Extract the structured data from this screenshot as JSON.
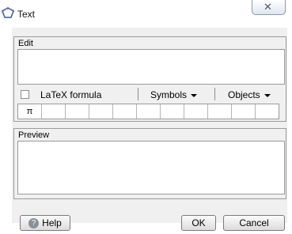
{
  "window": {
    "title": "Text",
    "close_glyph": "✕"
  },
  "edit": {
    "label": "Edit",
    "value": ""
  },
  "toolbar": {
    "latex_label": "LaTeX formula",
    "latex_checked": false,
    "symbols_label": "Symbols",
    "objects_label": "Objects"
  },
  "symbols": [
    "π",
    "",
    "",
    "",
    "",
    "",
    "",
    "",
    "",
    "",
    ""
  ],
  "preview": {
    "label": "Preview",
    "value": ""
  },
  "buttons": {
    "help": "Help",
    "ok": "OK",
    "cancel": "Cancel"
  },
  "icons": {
    "title": "geogebra-text-icon",
    "help": "help-icon"
  }
}
